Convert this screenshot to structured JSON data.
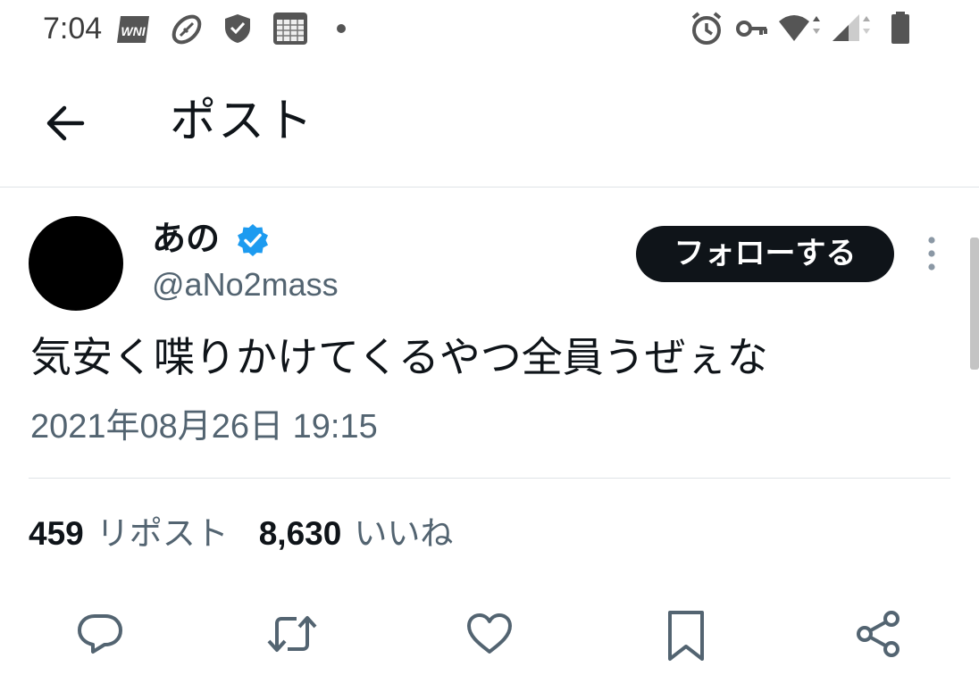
{
  "status_bar": {
    "time": "7:04",
    "left_icons": [
      "wni-icon",
      "football-icon",
      "shield-check-icon",
      "calendar-grid-icon",
      "dot-icon"
    ],
    "right_icons": [
      "alarm-icon",
      "key-icon",
      "wifi-icon",
      "signal-icon",
      "battery-icon"
    ]
  },
  "header": {
    "title": "ポスト",
    "back_icon": "arrow-left-icon"
  },
  "tweet": {
    "display_name": "あの",
    "handle": "@aNo2mass",
    "verified": true,
    "follow_label": "フォローする",
    "text": "気安く喋りかけてくるやつ全員うぜぇな",
    "timestamp": "2021年08月26日 19:15",
    "stats": {
      "reposts_count": "459",
      "reposts_label": "リポスト",
      "likes_count": "8,630",
      "likes_label": "いいね"
    }
  },
  "actions": [
    "reply-icon",
    "repost-icon",
    "like-icon",
    "bookmark-icon",
    "share-icon"
  ],
  "colors": {
    "text_primary": "#0f1419",
    "text_secondary": "#536471",
    "verified_blue": "#1d9bf0",
    "follow_button_bg": "#0f1419",
    "divider": "#dfe3e6"
  }
}
